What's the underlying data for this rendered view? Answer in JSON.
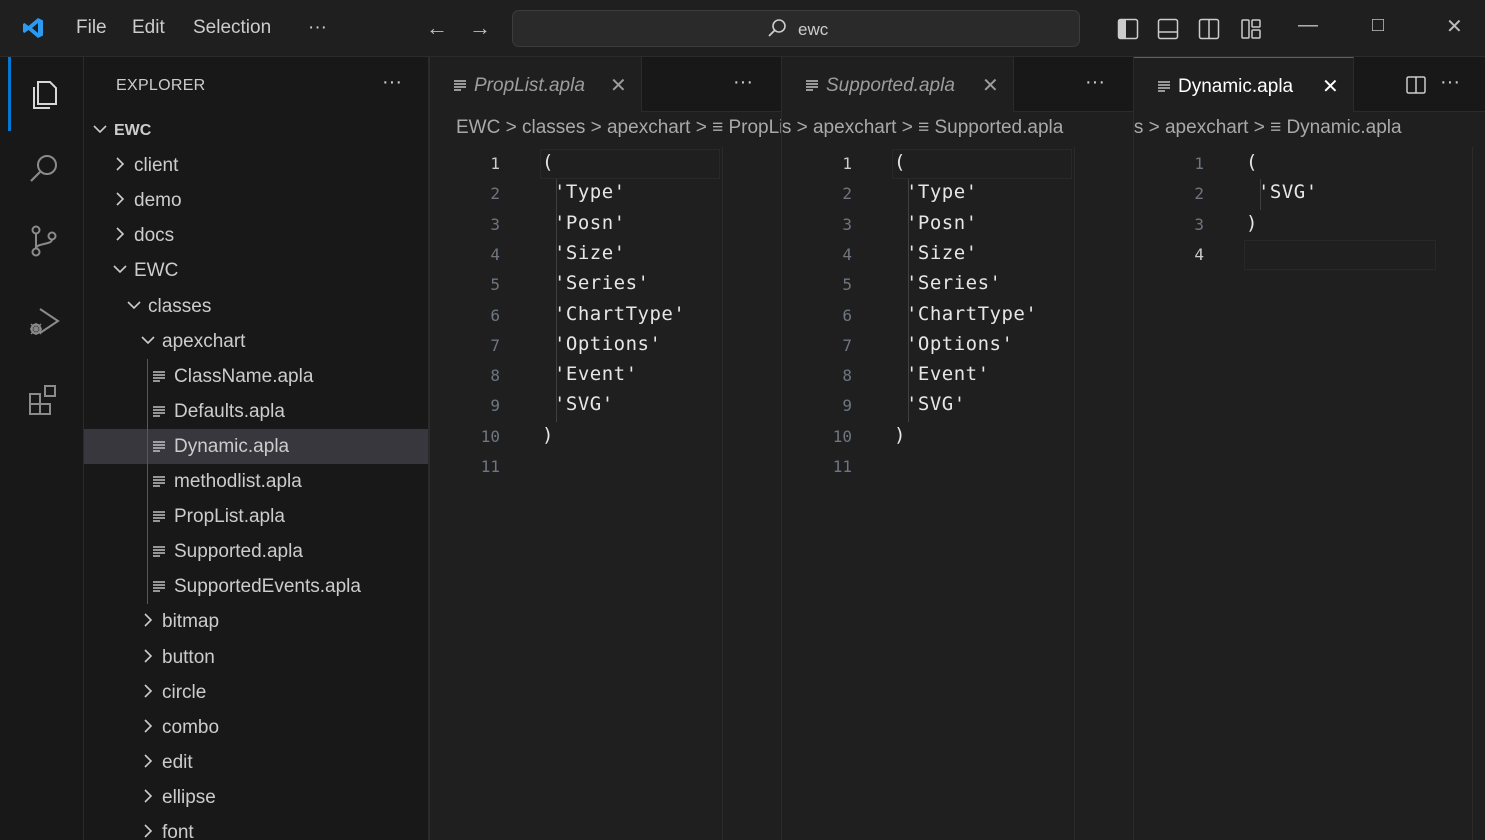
{
  "menu": {
    "file": "File",
    "edit": "Edit",
    "selection": "Selection",
    "more": "···"
  },
  "search": {
    "query": "ewc"
  },
  "window": {
    "minimize": "—",
    "maximize": "□",
    "close": "✕"
  },
  "sidebar": {
    "title": "EXPLORER",
    "more": "···",
    "tree": [
      {
        "label": "EWC",
        "kind": "root",
        "chevron": "down",
        "depth": 0
      },
      {
        "label": "client",
        "kind": "folder",
        "chevron": "right",
        "depth": 1
      },
      {
        "label": "demo",
        "kind": "folder",
        "chevron": "right",
        "depth": 1
      },
      {
        "label": "docs",
        "kind": "folder",
        "chevron": "right",
        "depth": 1
      },
      {
        "label": "EWC",
        "kind": "folder",
        "chevron": "down",
        "depth": 1
      },
      {
        "label": "classes",
        "kind": "folder",
        "chevron": "down",
        "depth": 2
      },
      {
        "label": "apexchart",
        "kind": "folder",
        "chevron": "down",
        "depth": 3
      },
      {
        "label": "ClassName.apla",
        "kind": "file",
        "depth": 4
      },
      {
        "label": "Defaults.apla",
        "kind": "file",
        "depth": 4
      },
      {
        "label": "Dynamic.apla",
        "kind": "file",
        "depth": 4,
        "selected": true
      },
      {
        "label": "methodlist.apla",
        "kind": "file",
        "depth": 4
      },
      {
        "label": "PropList.apla",
        "kind": "file",
        "depth": 4
      },
      {
        "label": "Supported.apla",
        "kind": "file",
        "depth": 4
      },
      {
        "label": "SupportedEvents.apla",
        "kind": "file",
        "depth": 4
      },
      {
        "label": "bitmap",
        "kind": "folder",
        "chevron": "right",
        "depth": 3
      },
      {
        "label": "button",
        "kind": "folder",
        "chevron": "right",
        "depth": 3
      },
      {
        "label": "circle",
        "kind": "folder",
        "chevron": "right",
        "depth": 3
      },
      {
        "label": "combo",
        "kind": "folder",
        "chevron": "right",
        "depth": 3
      },
      {
        "label": "edit",
        "kind": "folder",
        "chevron": "right",
        "depth": 3
      },
      {
        "label": "ellipse",
        "kind": "folder",
        "chevron": "right",
        "depth": 3
      },
      {
        "label": "font",
        "kind": "folder",
        "chevron": "right",
        "depth": 3
      }
    ]
  },
  "editors": [
    {
      "tab": "PropList.apla",
      "active": false,
      "close": "✕",
      "more": "···",
      "breadcrumb": "EWC > classes > apexchart > ≡ PropList.apla",
      "lines": [
        "(",
        " 'Type'",
        " 'Posn'",
        " 'Size'",
        " 'Series'",
        " 'ChartType'",
        " 'Options'",
        " 'Event'",
        " 'SVG'",
        ")",
        ""
      ],
      "cursor_line": 1
    },
    {
      "tab": "Supported.apla",
      "active": false,
      "close": "✕",
      "more": "···",
      "breadcrumb": "EWC > classes > apexchart > ≡ Supported.apla",
      "lines": [
        "(",
        " 'Type'",
        " 'Posn'",
        " 'Size'",
        " 'Series'",
        " 'ChartType'",
        " 'Options'",
        " 'Event'",
        " 'SVG'",
        ")",
        ""
      ],
      "cursor_line": 1
    },
    {
      "tab": "Dynamic.apla",
      "active": true,
      "close": "✕",
      "more": "···",
      "breadcrumb": "EWC > classes > apexchart > ≡ Dynamic.apla",
      "lines": [
        "(",
        " 'SVG'",
        ")",
        ""
      ],
      "cursor_line": 4
    }
  ],
  "colors": {
    "accent": "#0078d4",
    "selected_row": "#37373d",
    "editor_bg": "#1f1f1f",
    "sidebar_bg": "#181818"
  }
}
